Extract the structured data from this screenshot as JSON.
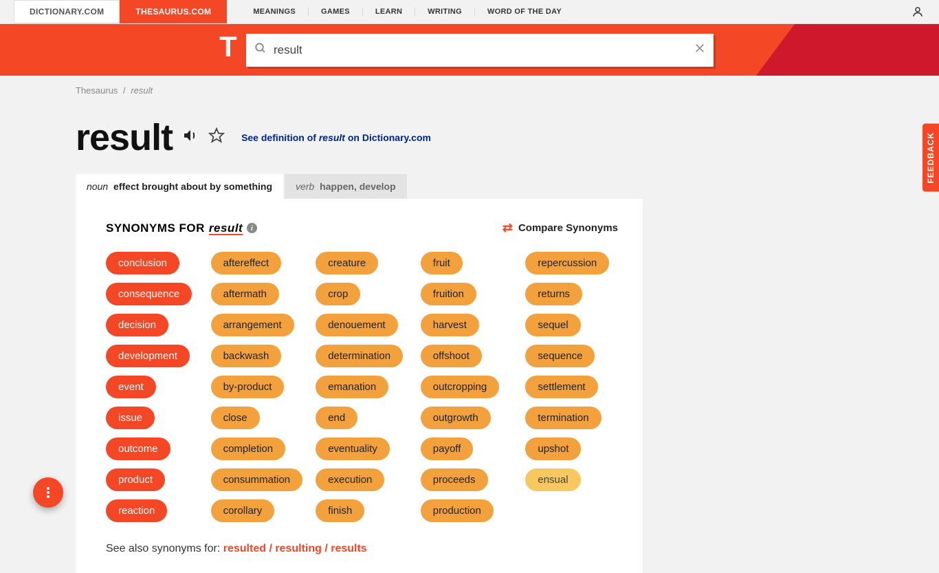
{
  "topnav": {
    "site_tabs": [
      {
        "label": "DICTIONARY.COM",
        "active": false
      },
      {
        "label": "THESAURUS.COM",
        "active": true
      }
    ],
    "links": [
      "MEANINGS",
      "GAMES",
      "LEARN",
      "WRITING",
      "WORD OF THE DAY"
    ]
  },
  "search": {
    "value": "result"
  },
  "breadcrumb": {
    "root": "Thesaurus",
    "term": "result"
  },
  "headword": "result",
  "definition_link": {
    "pre": "See definition of ",
    "word": "result",
    "post": " on Dictionary.com"
  },
  "tabs": [
    {
      "pos": "noun",
      "def": "effect brought about by something",
      "active": true
    },
    {
      "pos": "verb",
      "def": "happen, develop",
      "active": false
    }
  ],
  "syn_header": {
    "label": "SYNONYMS FOR",
    "term": "result"
  },
  "compare_label": "Compare Synonyms",
  "synonyms": {
    "col1": [
      {
        "w": "conclusion",
        "s": "strong"
      },
      {
        "w": "consequence",
        "s": "strong"
      },
      {
        "w": "decision",
        "s": "strong"
      },
      {
        "w": "development",
        "s": "strong"
      },
      {
        "w": "event",
        "s": "strong"
      },
      {
        "w": "issue",
        "s": "strong"
      },
      {
        "w": "outcome",
        "s": "strong"
      },
      {
        "w": "product",
        "s": "strong"
      },
      {
        "w": "reaction",
        "s": "strong"
      }
    ],
    "col2": [
      {
        "w": "aftereffect",
        "s": "med"
      },
      {
        "w": "aftermath",
        "s": "med"
      },
      {
        "w": "arrangement",
        "s": "med"
      },
      {
        "w": "backwash",
        "s": "med"
      },
      {
        "w": "by-product",
        "s": "med"
      },
      {
        "w": "close",
        "s": "med"
      },
      {
        "w": "completion",
        "s": "med"
      },
      {
        "w": "consummation",
        "s": "med"
      },
      {
        "w": "corollary",
        "s": "med"
      }
    ],
    "col3": [
      {
        "w": "creature",
        "s": "med"
      },
      {
        "w": "crop",
        "s": "med"
      },
      {
        "w": "denouement",
        "s": "med"
      },
      {
        "w": "determination",
        "s": "med"
      },
      {
        "w": "emanation",
        "s": "med"
      },
      {
        "w": "end",
        "s": "med"
      },
      {
        "w": "eventuality",
        "s": "med"
      },
      {
        "w": "execution",
        "s": "med"
      },
      {
        "w": "finish",
        "s": "med"
      }
    ],
    "col4": [
      {
        "w": "fruit",
        "s": "med"
      },
      {
        "w": "fruition",
        "s": "med"
      },
      {
        "w": "harvest",
        "s": "med"
      },
      {
        "w": "offshoot",
        "s": "med"
      },
      {
        "w": "outcropping",
        "s": "med"
      },
      {
        "w": "outgrowth",
        "s": "med"
      },
      {
        "w": "payoff",
        "s": "med"
      },
      {
        "w": "proceeds",
        "s": "med"
      },
      {
        "w": "production",
        "s": "med"
      }
    ],
    "col5": [
      {
        "w": "repercussion",
        "s": "med"
      },
      {
        "w": "returns",
        "s": "med"
      },
      {
        "w": "sequel",
        "s": "med"
      },
      {
        "w": "sequence",
        "s": "med"
      },
      {
        "w": "settlement",
        "s": "med"
      },
      {
        "w": "termination",
        "s": "med"
      },
      {
        "w": "upshot",
        "s": "med"
      },
      {
        "w": "ensual",
        "s": "weak"
      }
    ]
  },
  "see_also": {
    "label": "See also synonyms for: ",
    "forms": "resulted / resulting / results"
  },
  "feedback": "FEEDBACK"
}
